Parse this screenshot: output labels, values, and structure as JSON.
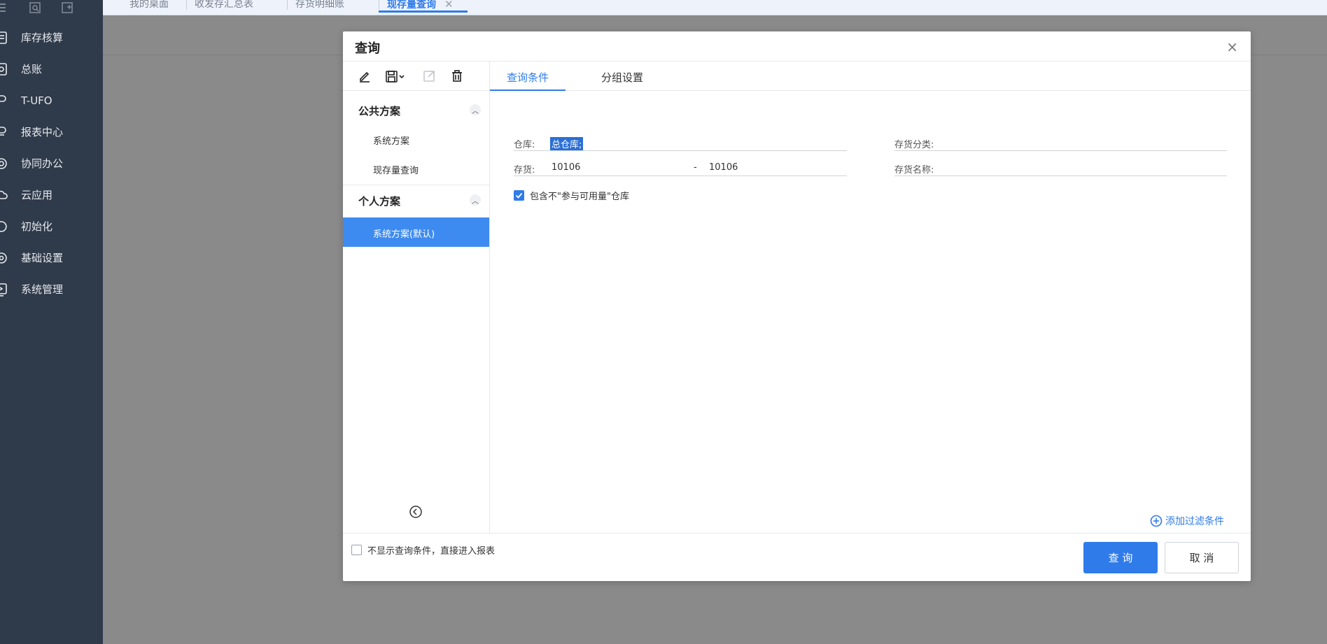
{
  "sidebar": {
    "top_icons": [
      "menu-icon",
      "search-doc-icon",
      "add-doc-icon"
    ],
    "items": [
      {
        "label": "库存核算",
        "icon": "inventory-calc-icon"
      },
      {
        "label": "总账",
        "icon": "ledger-icon"
      },
      {
        "label": "T-UFO",
        "icon": "tufo-icon"
      },
      {
        "label": "报表中心",
        "icon": "report-center-icon"
      },
      {
        "label": "协同办公",
        "icon": "collaboration-icon"
      },
      {
        "label": "云应用",
        "icon": "cloud-icon"
      },
      {
        "label": "初始化",
        "icon": "initialize-icon"
      },
      {
        "label": "基础设置",
        "icon": "basic-settings-icon"
      },
      {
        "label": "系统管理",
        "icon": "system-admin-icon"
      }
    ]
  },
  "tabs": [
    {
      "label": "我的桌面"
    },
    {
      "label": "收发存汇总表"
    },
    {
      "label": "存货明细账"
    },
    {
      "label": "现存量查询",
      "active": true
    }
  ],
  "dialog": {
    "title": "查询",
    "close_glyph": "×",
    "schemes": {
      "public_title": "公共方案",
      "public_items": [
        "系统方案",
        "现存量查询"
      ],
      "personal_title": "个人方案",
      "personal_items": [
        "系统方案(默认)"
      ]
    },
    "right_tabs": [
      {
        "label": "查询条件",
        "active": true
      },
      {
        "label": "分组设置"
      }
    ],
    "fields": {
      "warehouse_label": "仓库:",
      "warehouse_value": "总仓库;",
      "category_label": "存货分类:",
      "inventory_label": "存货:",
      "inventory_from": "10106",
      "inventory_dash": "-",
      "inventory_to": "10106",
      "name_label": "存货名称:"
    },
    "include_checkbox_label": "包含不\"参与可用量\"仓库",
    "include_checked": true,
    "add_filter_label": "添加过滤条件",
    "footer": {
      "skip_checkbox_label": "不显示查询条件，直接进入报表",
      "skip_checked": false,
      "query_button": "查 询",
      "cancel_button": "取 消"
    }
  },
  "colors": {
    "accent": "#2f7bea",
    "sidebar_bg": "#2f3a4a",
    "selected_item_bg": "#3d8bf0"
  }
}
